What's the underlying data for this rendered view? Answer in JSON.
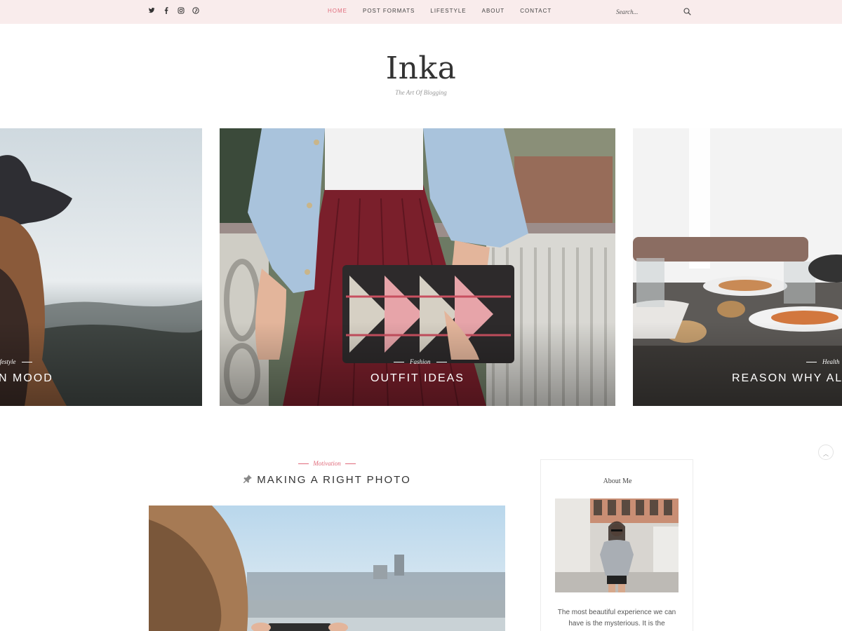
{
  "topbar": {
    "social": [
      {
        "icon": "twitter-icon",
        "glyph": "🐦"
      },
      {
        "icon": "facebook-icon",
        "glyph": "f"
      },
      {
        "icon": "instagram-icon",
        "glyph": "◎"
      },
      {
        "icon": "pinterest-icon",
        "glyph": "℗"
      }
    ],
    "nav": [
      {
        "label": "HOME",
        "active": true
      },
      {
        "label": "POST FORMATS",
        "active": false
      },
      {
        "label": "LIFESTYLE",
        "active": false
      },
      {
        "label": "ABOUT",
        "active": false
      },
      {
        "label": "CONTACT",
        "active": false
      }
    ],
    "search_placeholder": "Search..."
  },
  "site": {
    "title": "Inka",
    "tagline": "The Art Of Blogging"
  },
  "slider": [
    {
      "category": "Lifestyle",
      "title": "N MOOD"
    },
    {
      "category": "Fashion",
      "title": "OUTFIT IDEAS"
    },
    {
      "category": "Health",
      "title": "REASON WHY ALV"
    }
  ],
  "post": {
    "category": "Motivation",
    "title": "MAKING A RIGHT PHOTO"
  },
  "sidebar": {
    "about_title": "About Me",
    "about_text": "The most beautiful experience we can have is the mysterious. It is the"
  },
  "colors": {
    "accent": "#e06b7b",
    "topbar_bg": "#f9ecec"
  }
}
